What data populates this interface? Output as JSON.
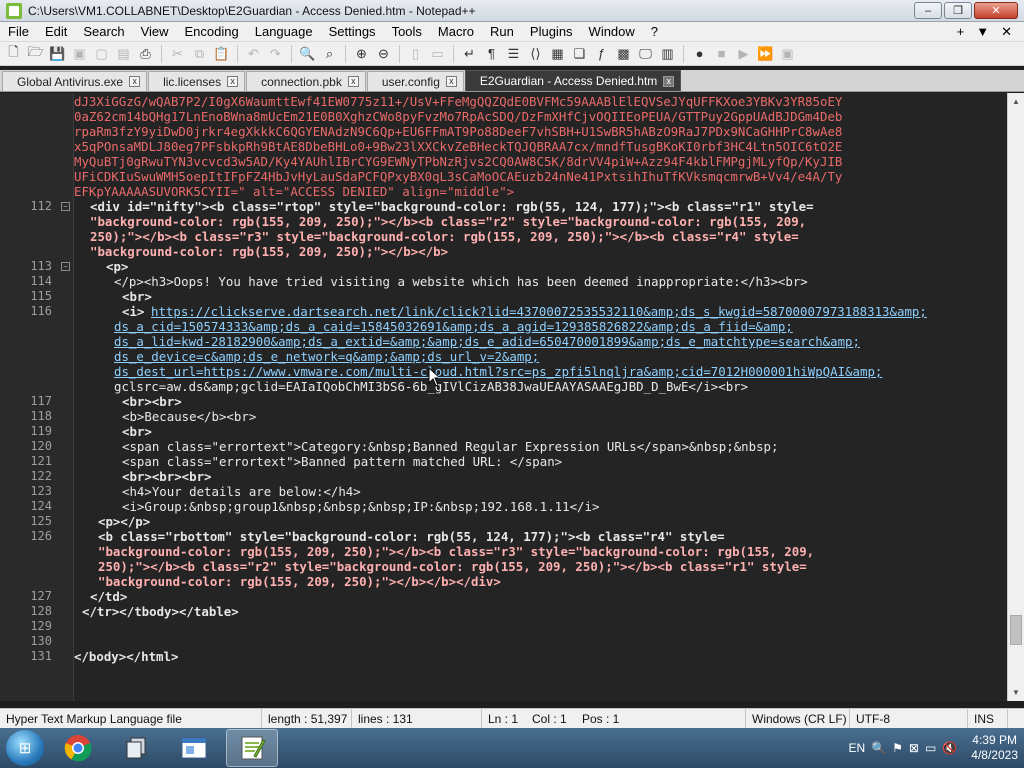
{
  "window": {
    "title": "C:\\Users\\VM1.COLLABNET\\Desktop\\E2Guardian - Access Denied.htm - Notepad++",
    "minimize": "–",
    "maximize": "❐",
    "close": "✕"
  },
  "menu": {
    "items": [
      "File",
      "Edit",
      "Search",
      "View",
      "Encoding",
      "Language",
      "Settings",
      "Tools",
      "Macro",
      "Run",
      "Plugins",
      "Window",
      "?"
    ],
    "right_plus": "+",
    "right_dropdown": "▼",
    "right_close": "✕"
  },
  "tabs": [
    {
      "label": "Global Antivirus.exe",
      "active": false
    },
    {
      "label": "lic.licenses",
      "active": false
    },
    {
      "label": "connection.pbk",
      "active": false
    },
    {
      "label": "user.config",
      "active": false
    },
    {
      "label": "E2Guardian - Access Denied.htm",
      "active": true
    }
  ],
  "tab_close": "x",
  "code": {
    "base64_lines": [
      "dJ3XiGGzG/wQAB7P2/I0gX6WaumttEwf41EW0775z11+/UsV+FFeMgQQZQdE0BVFMc59AAABlElEQVSeJYqUFFKXoe3YBKv3YR85oEY",
      "0aZ62cm14bQHg17LnEnoBWna8mUcEm21E0B0XghzCWo8pyFvzMo7RpAcSDQ/DzFmXHfCjvOQIIEoPEUA/GTTPuy2GppUAdBJDGm4Deb",
      "rpaRm3fzY9yiDwD0jrkr4egXkkkC6QGYENAdzN9C6Qp+EU6FFmAT9Po88DeeF7vhSBH+U1SwBR5hABzO9RaJ7PDx9NCaGHHPrC8wAe8",
      "x5qPOnsaMDLJ80eg7PFsbkpRh9BtAE8DbeBHLo0+9Bw23lXXCkvZeBHeckTQJQBRAA7cx/mndfTusgBKoKI0rbf3HC4Ltn5OIC6tO2E",
      "MyQuBTj0gRwuTYN3vcvcd3w5AD/Ky4YAUhlIBrCYG9EWNyTPbNzRjvs2CQ0AW8C5K/8drVV4piW+Azz94F4kblFMPgjMLyfQp/KyJIB",
      "UFiCDKIuSwuWMH5oepItIFpFZ4HbJvHyLauSdaPCFQPxyBX0qL3sCaMoOCAEuzb24nNe41PxtsihIhuTfKVksmqcmrwB+Vv4/e4A/Ty",
      "EFKpYAAAAASUVORK5CYII=\" alt=\"ACCESS DENIED\" align=\"middle\">"
    ],
    "line_numbers": [
      "112",
      "113",
      "114",
      "115",
      "116",
      "117",
      "118",
      "119",
      "120",
      "121",
      "122",
      "123",
      "124",
      "125",
      "126",
      "127",
      "128",
      "129",
      "130",
      "131"
    ],
    "l112a": "<div id=\"nifty\"><b class=\"rtop\" style=\"background-color: rgb(55, 124, 177);\"><b class=\"r1\" style=",
    "l112b": "\"background-color: rgb(155, 209, 250);\"></b><b class=\"r2\" style=\"background-color: rgb(155, 209,",
    "l112c": "250);\"></b><b class=\"r3\" style=\"background-color: rgb(155, 209, 250);\"></b><b class=\"r4\" style=",
    "l112d": "\"background-color: rgb(155, 209, 250);\"></b></b>",
    "l113": "<p>",
    "l114": "</p><h3>Oops! You have tried visiting a website which has been deemed inappropriate:</h3><br>",
    "l115": "<br>",
    "l116_prefix": "<i>",
    "l116a": "https://clickserve.dartsearch.net/link/click?lid=43700072535532110&amp;ds_s_kwgid=58700007973188313&amp;",
    "l116b": "ds_a_cid=150574333&amp;ds_a_caid=15845032691&amp;ds_a_agid=129385826822&amp;ds_a_fiid=&amp;",
    "l116c": "ds_a_lid=kwd-28182900&amp;ds_a_extid=&amp;&amp;ds_e_adid=650470001899&amp;ds_e_matchtype=search&amp;",
    "l116d": "ds_e_device=c&amp;ds_e_network=q&amp;&amp;ds_url_v=2&amp;",
    "l116e": "ds_dest_url=https://www.vmware.com/multi-cloud.html?src=ps_zpfi5lnqljra&amp;cid=7012H000001hiWpQAI&amp;",
    "l116f": "gclsrc=aw.ds&amp;gclid=EAIaIQobChMI3bS6-6b_gIVlCizAB38JwaUEAAYASAAEgJBD_D_BwE</i><br>",
    "l117": "<br><br>",
    "l118": "<b>Because</b><br>",
    "l119": "<br>",
    "l120": "<span class=\"errortext\">Category:&nbsp;Banned Regular Expression URLs</span>&nbsp;&nbsp;",
    "l121": "<span class=\"errortext\">Banned pattern matched URL: </span>",
    "l122": "<br><br><br>",
    "l123": "<h4>Your details are below:</h4>",
    "l124": "<i>Group:&nbsp;group1&nbsp;&nbsp;&nbsp;IP:&nbsp;192.168.1.11</i>",
    "l125": "<p></p>",
    "l126a": "<b class=\"rbottom\" style=\"background-color: rgb(55, 124, 177);\"><b class=\"r4\" style=",
    "l126b": "\"background-color: rgb(155, 209, 250);\"></b><b class=\"r3\" style=\"background-color: rgb(155, 209,",
    "l126c": "250);\"></b><b class=\"r2\" style=\"background-color: rgb(155, 209, 250);\"></b><b class=\"r1\" style=",
    "l126d": "\"background-color: rgb(155, 209, 250);\"></b></b></div>",
    "l127": "</td>",
    "l128": "</tr></tbody></table>",
    "l131": "</body></html>"
  },
  "status": {
    "filetype": "Hyper Text Markup Language file",
    "length": "length : 51,397",
    "lines": "lines : 131",
    "ln": "Ln : 1",
    "col": "Col : 1",
    "pos": "Pos : 1",
    "eol": "Windows (CR LF)",
    "encoding": "UTF-8",
    "mode": "INS"
  },
  "taskbar": {
    "lang": "EN",
    "time": "4:39 PM",
    "date": "4/8/2023"
  }
}
